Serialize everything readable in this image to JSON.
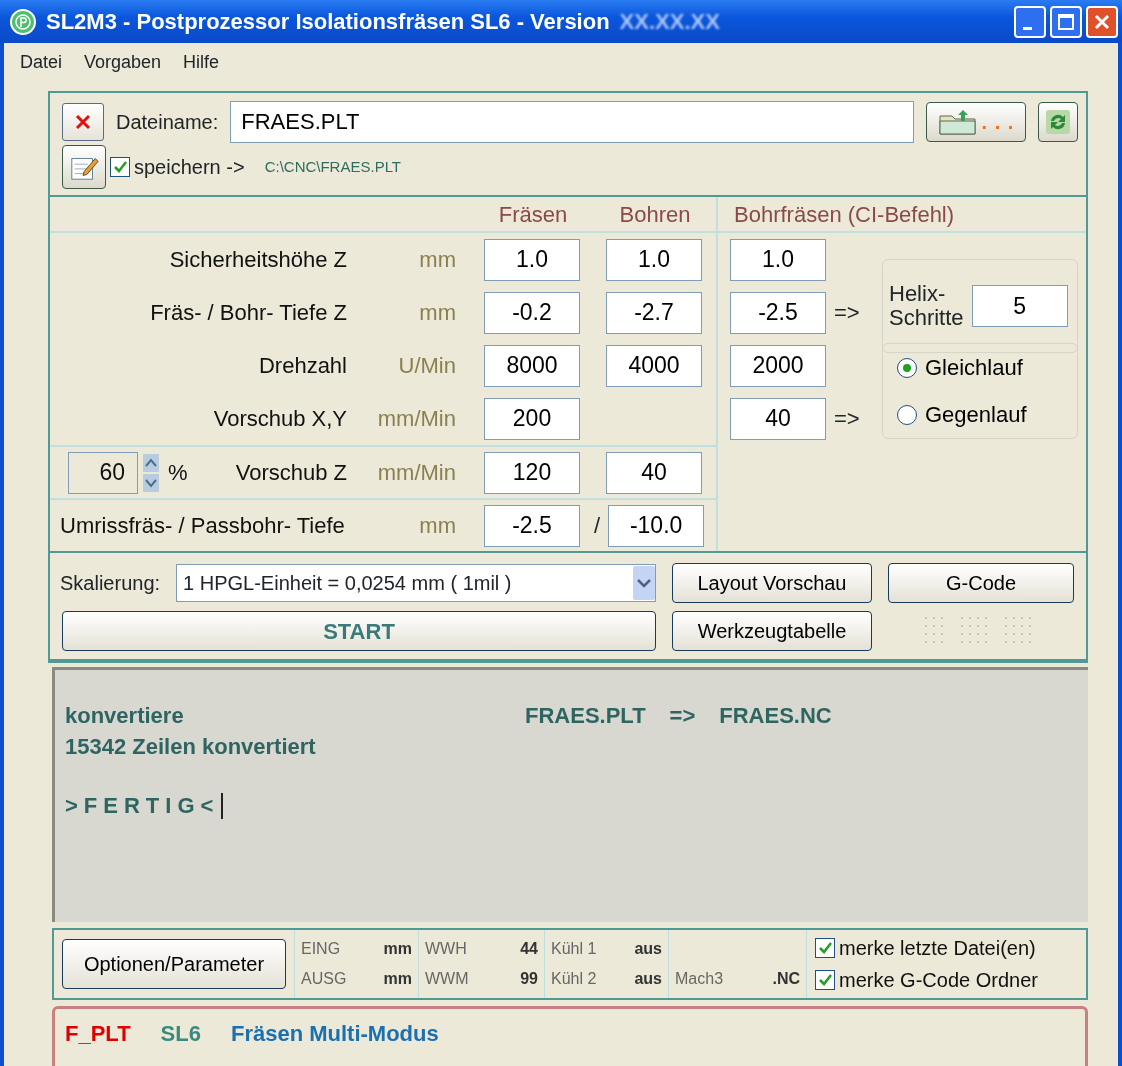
{
  "window": {
    "title": "SL2M3  -  Postprozessor  Isolationsfräsen SL6 -  Version",
    "version": "XX.XX.XX"
  },
  "menu": [
    "Datei",
    "Vorgaben",
    "Hilfe"
  ],
  "file": {
    "label": "Dateiname:",
    "value": "FRAES.PLT",
    "browse_dots": ". . .",
    "save_label": "speichern ->",
    "save_checked": true,
    "save_path": "C:\\CNC\\FRAES.PLT"
  },
  "columns": [
    "Fräsen",
    "Bohren",
    "Bohrfräsen  (CI-Befehl)"
  ],
  "params": [
    {
      "kind": "plain",
      "label": "Sicherheitshöhe Z",
      "unit": "mm",
      "fraesen": "1.0",
      "bohren": "1.0",
      "bohrfraesen": "1.0"
    },
    {
      "kind": "plain",
      "label": "Fräs- / Bohr- Tiefe Z",
      "unit": "mm",
      "fraesen": "-0.2",
      "bohren": "-2.7",
      "bohrfraesen": "-2.5",
      "arrow": "=>"
    },
    {
      "kind": "plain",
      "label": "Drehzahl",
      "unit": "U/Min",
      "fraesen": "8000",
      "bohren": "4000",
      "bohrfraesen": "2000"
    },
    {
      "kind": "plain",
      "label": "Vorschub X,Y",
      "unit": "mm/Min",
      "fraesen": "200",
      "bohrfraesen": "40",
      "arrow": "=>"
    },
    {
      "kind": "percent",
      "percent": "60",
      "percent_sign": "%",
      "label": "Vorschub Z",
      "unit": "mm/Min",
      "fraesen": "120",
      "bohren": "40"
    },
    {
      "kind": "outline",
      "label": "Umrissfräs- / Passbohr- Tiefe",
      "unit": "mm",
      "fraesen": "-2.5",
      "bohren": "-10.0",
      "separator": "/"
    }
  ],
  "helix": {
    "label_lines": [
      "Helix-",
      "Schritte"
    ],
    "value": "5"
  },
  "direction": [
    {
      "label": "Gleichlauf",
      "selected": true
    },
    {
      "label": "Gegenlauf",
      "selected": false
    }
  ],
  "scaling": {
    "label": "Skalierung:",
    "value": "1 HPGL-Einheit = 0,0254 mm ( 1mil )"
  },
  "buttons": {
    "start": "START",
    "preview": "Layout Vorschau",
    "gcode": "G-Code",
    "tools": "Werkzeugtabelle"
  },
  "console": {
    "convert": "konvertiere",
    "file_in": "FRAES.PLT",
    "arrow": "=>",
    "file_out": "FRAES.NC",
    "lines": "15342  Zeilen konvertiert",
    "done": ">FERTIG<"
  },
  "footer": {
    "options": "Optionen/Parameter",
    "cells": [
      [
        {
          "label": "EING",
          "value": "mm"
        },
        {
          "label": "AUSG",
          "value": "mm"
        }
      ],
      [
        {
          "label": "WWH",
          "value": "44"
        },
        {
          "label": "WWM",
          "value": "99"
        }
      ],
      [
        {
          "label": "Kühl 1",
          "value": "aus"
        },
        {
          "label": "Kühl 2",
          "value": "aus"
        }
      ],
      [
        null,
        {
          "label": "Mach3",
          "value": ".NC"
        }
      ]
    ],
    "checks": [
      {
        "label": "merke letzte Datei(en)",
        "checked": true
      },
      {
        "label": "merke G-Code Ordner",
        "checked": true
      }
    ]
  },
  "status": [
    {
      "text": "F_PLT",
      "color": "#e00000"
    },
    {
      "text": "SL6",
      "color": "#3a8a80"
    },
    {
      "text": "Fräsen Multi-Modus",
      "color": "#1a70b0"
    }
  ]
}
